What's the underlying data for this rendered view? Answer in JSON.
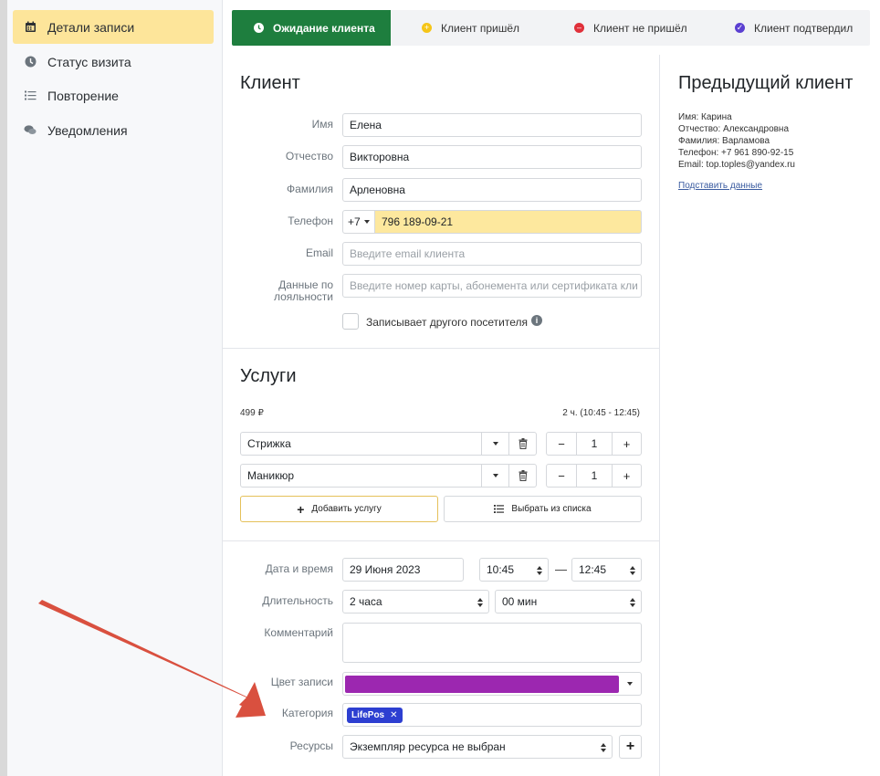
{
  "sidebar": {
    "items": [
      {
        "label": "Детали записи",
        "icon": "calendar-icon",
        "active": true
      },
      {
        "label": "Статус визита",
        "icon": "clock-icon",
        "active": false
      },
      {
        "label": "Повторение",
        "icon": "list-icon",
        "active": false
      },
      {
        "label": "Уведомления",
        "icon": "chat-icon",
        "active": false
      }
    ]
  },
  "status_tabs": [
    {
      "label": "Ожидание клиента",
      "icon": "clock-icon",
      "color": "#1e7e3e",
      "active": true
    },
    {
      "label": "Клиент пришёл",
      "icon": "plus-circle-icon",
      "color": "#f5c518",
      "active": false
    },
    {
      "label": "Клиент не пришёл",
      "icon": "minus-circle-icon",
      "color": "#e0303a",
      "active": false
    },
    {
      "label": "Клиент подтвердил",
      "icon": "check-circle-icon",
      "color": "#5b3fd1",
      "active": false
    }
  ],
  "client": {
    "title": "Клиент",
    "first_name_label": "Имя",
    "first_name": "Елена",
    "patronymic_label": "Отчество",
    "patronymic": "Викторовна",
    "last_name_label": "Фамилия",
    "last_name": "Арленовна",
    "phone_label": "Телефон",
    "phone_code": "+7",
    "phone": "796 189-09-21",
    "email_label": "Email",
    "email_placeholder": "Введите email клиента",
    "loyalty_label": "Данные по лояльности",
    "loyalty_placeholder": "Введите номер карты, абонемента или сертификата кли",
    "other_visitor_label": "Записывает другого посетителя"
  },
  "services": {
    "title": "Услуги",
    "price": "499 ₽",
    "duration": "2 ч. (10:45 - 12:45)",
    "items": [
      {
        "name": "Стрижка",
        "qty": "1"
      },
      {
        "name": "Маникюр",
        "qty": "1"
      }
    ],
    "add_label": "Добавить услугу",
    "choose_label": "Выбрать из списка"
  },
  "booking": {
    "date_label": "Дата и время",
    "date": "29 Июня 2023",
    "time_start": "10:45",
    "time_dash": "—",
    "time_end": "12:45",
    "duration_label": "Длительность",
    "duration_hours": "2 часа",
    "duration_minutes": "00 мин",
    "comment_label": "Комментарий",
    "color_label": "Цвет записи",
    "color": "#9c27b0",
    "category_label": "Категория",
    "category_tag": "LifePos",
    "resources_label": "Ресурсы",
    "resources_value": "Экземпляр ресурса не выбран"
  },
  "previous_client": {
    "title": "Предыдущий клиент",
    "lines": [
      "Имя: Карина",
      "Отчество: Александровна",
      "Фамилия: Варламова",
      "Телефон: +7 961 890-92-15",
      "Email: top.toples@yandex.ru"
    ],
    "link": "Подставить данные"
  },
  "colors": {
    "arrow": "#d9503f",
    "active_sidebar": "#fde59a",
    "accent_green": "#1e7e3e"
  }
}
